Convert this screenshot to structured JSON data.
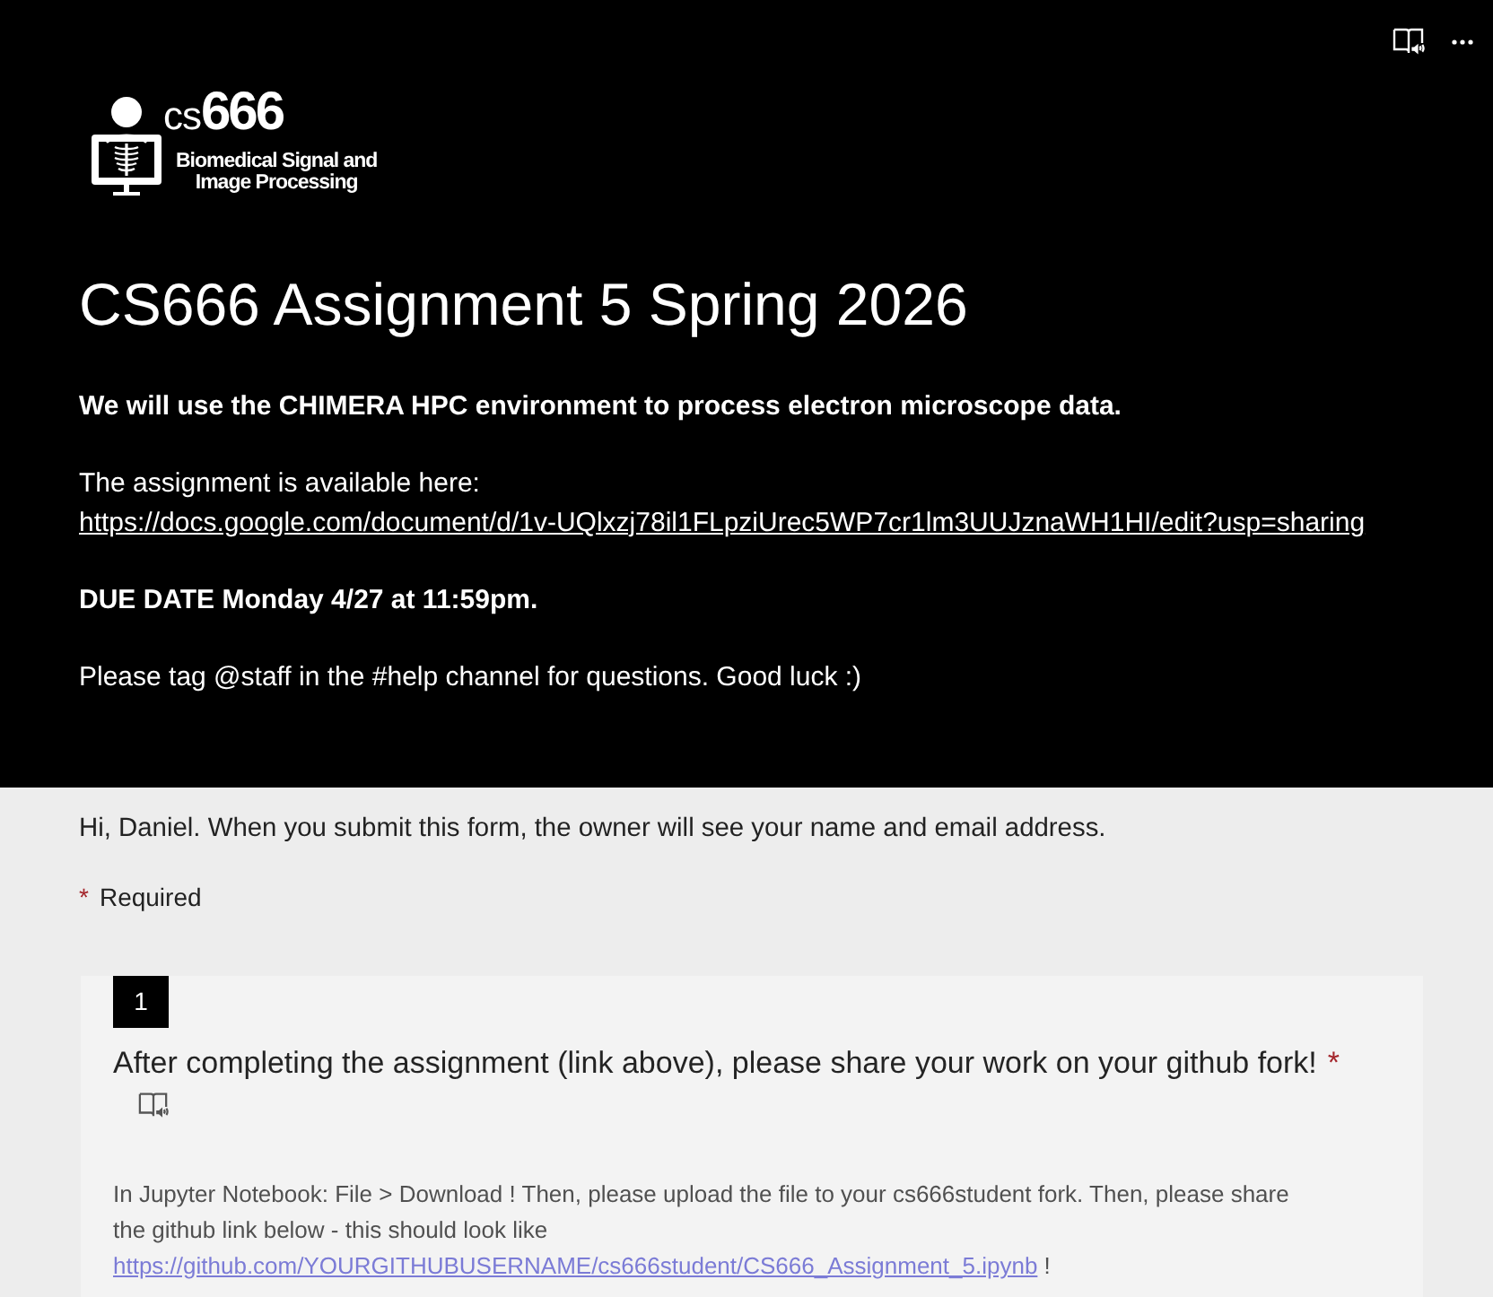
{
  "header": {
    "logo": {
      "prefix": "cs",
      "number": "666",
      "subtitle_lines": [
        "Biomedical Signal and",
        "Image Processing"
      ]
    },
    "title": "CS666 Assignment 5 Spring 2026",
    "description": [
      {
        "kind": "bold",
        "text": "We will use the CHIMERA HPC environment to process electron microscope data."
      },
      {
        "kind": "link",
        "text": "The assignment is available here: ",
        "link": "https://docs.google.com/document/d/1v-UQlxzj78il1FLpziUrec5WP7cr1lm3UUJznaWH1HI/edit?usp=sharing"
      },
      {
        "kind": "bold",
        "text": "DUE DATE Monday 4/27 at 11:59pm."
      },
      {
        "kind": "plain",
        "text": "Please tag @staff in the #help channel for questions. Good luck :)"
      }
    ]
  },
  "notice": "Hi, Daniel. When you submit this form, the owner will see your name and email address.",
  "required_note": {
    "mark": "*",
    "label": "Required"
  },
  "questions": [
    {
      "number": "1",
      "title": "After completing the assignment (link above), please share your work on your github fork!",
      "required_mark": "*",
      "description": {
        "text": "In Jupyter Notebook: File > Download ! Then, please upload the file to your cs666student fork. Then, please share the github link below - this should look like",
        "link": "https://github.com/YOURGITHUBUSERNAME/cs666student/CS666_Assignment_5.ipynb",
        "suffix": " !"
      }
    }
  ]
}
